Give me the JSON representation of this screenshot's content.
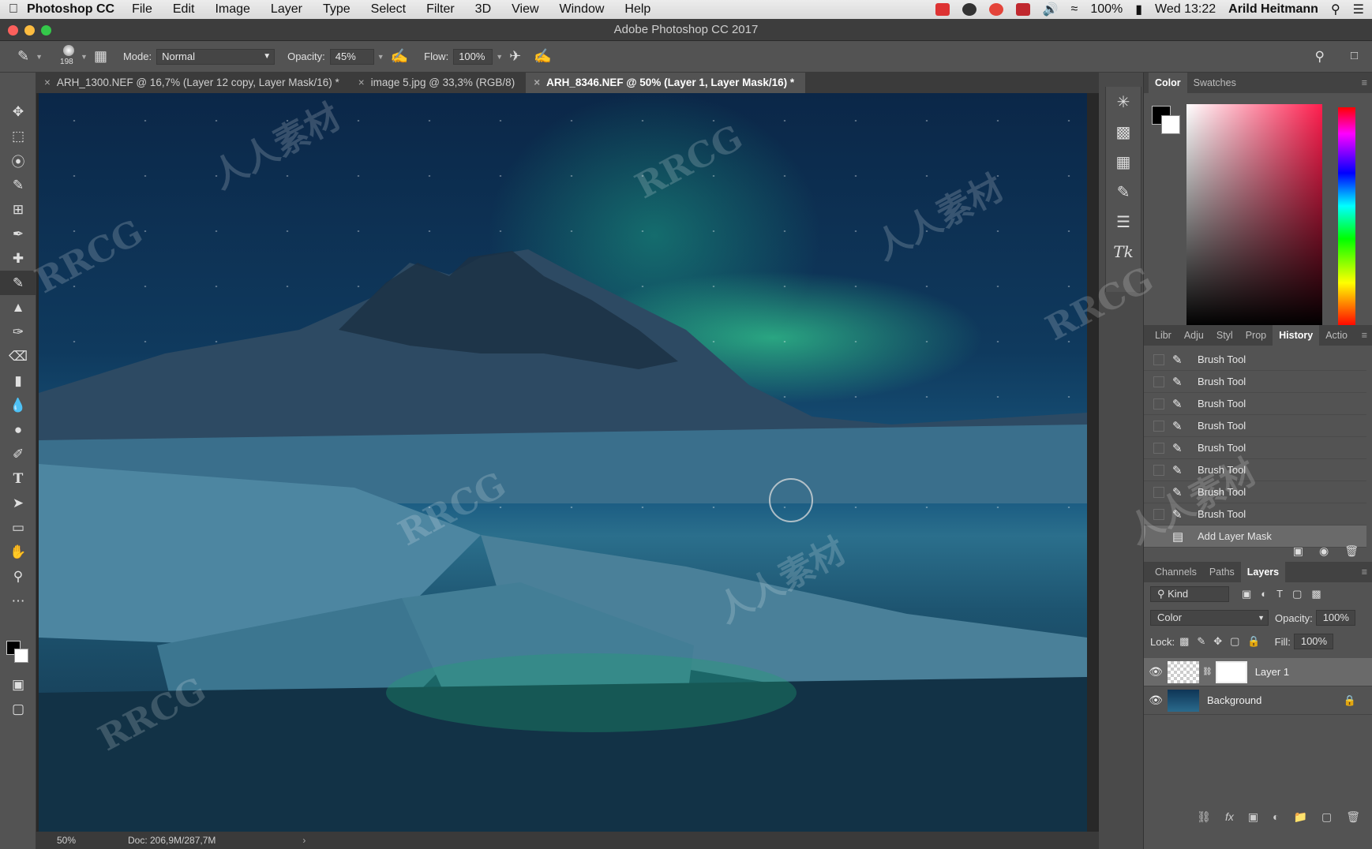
{
  "menubar": {
    "app_name": "Photoshop CC",
    "items": [
      "File",
      "Edit",
      "Image",
      "Layer",
      "Type",
      "Select",
      "Filter",
      "3D",
      "View",
      "Window",
      "Help"
    ],
    "battery": "100%",
    "clock": "Wed 13:22",
    "user": "Arild Heitmann"
  },
  "window": {
    "title": "Adobe Photoshop CC 2017"
  },
  "options": {
    "brush_size": "198",
    "mode_label": "Mode:",
    "mode_value": "Normal",
    "opacity_label": "Opacity:",
    "opacity_value": "45%",
    "flow_label": "Flow:",
    "flow_value": "100%"
  },
  "tabs": [
    {
      "label": "ARH_1300.NEF @ 16,7% (Layer 12 copy, Layer Mask/16) *",
      "active": false
    },
    {
      "label": "image 5.jpg @ 33,3% (RGB/8)",
      "active": false
    },
    {
      "label": "ARH_8346.NEF @ 50% (Layer 1, Layer Mask/16) *",
      "active": true
    }
  ],
  "status": {
    "zoom": "50%",
    "doc": "Doc: 206,9M/287,7M"
  },
  "color_panel": {
    "tabs": [
      "Color",
      "Swatches"
    ],
    "fg": "#000000",
    "bg": "#ffffff"
  },
  "history_panel": {
    "tabs": [
      "Libr",
      "Adju",
      "Styl",
      "Prop",
      "History",
      "Actio"
    ],
    "items": [
      "Brush Tool",
      "Brush Tool",
      "Brush Tool",
      "Brush Tool",
      "Brush Tool",
      "Brush Tool",
      "Brush Tool",
      "Brush Tool",
      "Add Layer Mask"
    ]
  },
  "layers_panel": {
    "tabs": [
      "Channels",
      "Paths",
      "Layers"
    ],
    "filter": "Kind",
    "blend_mode": "Color",
    "opacity_label": "Opacity:",
    "opacity_value": "100%",
    "lock_label": "Lock:",
    "fill_label": "Fill:",
    "fill_value": "100%",
    "layers": [
      {
        "name": "Layer 1",
        "selected": true
      },
      {
        "name": "Background",
        "selected": false
      }
    ]
  },
  "watermarks": [
    "RRCG",
    "人人素材",
    "RRCG",
    "人人素材",
    "RRCG",
    "人人素材",
    "RRCG",
    "RRCG",
    "人人素材"
  ]
}
